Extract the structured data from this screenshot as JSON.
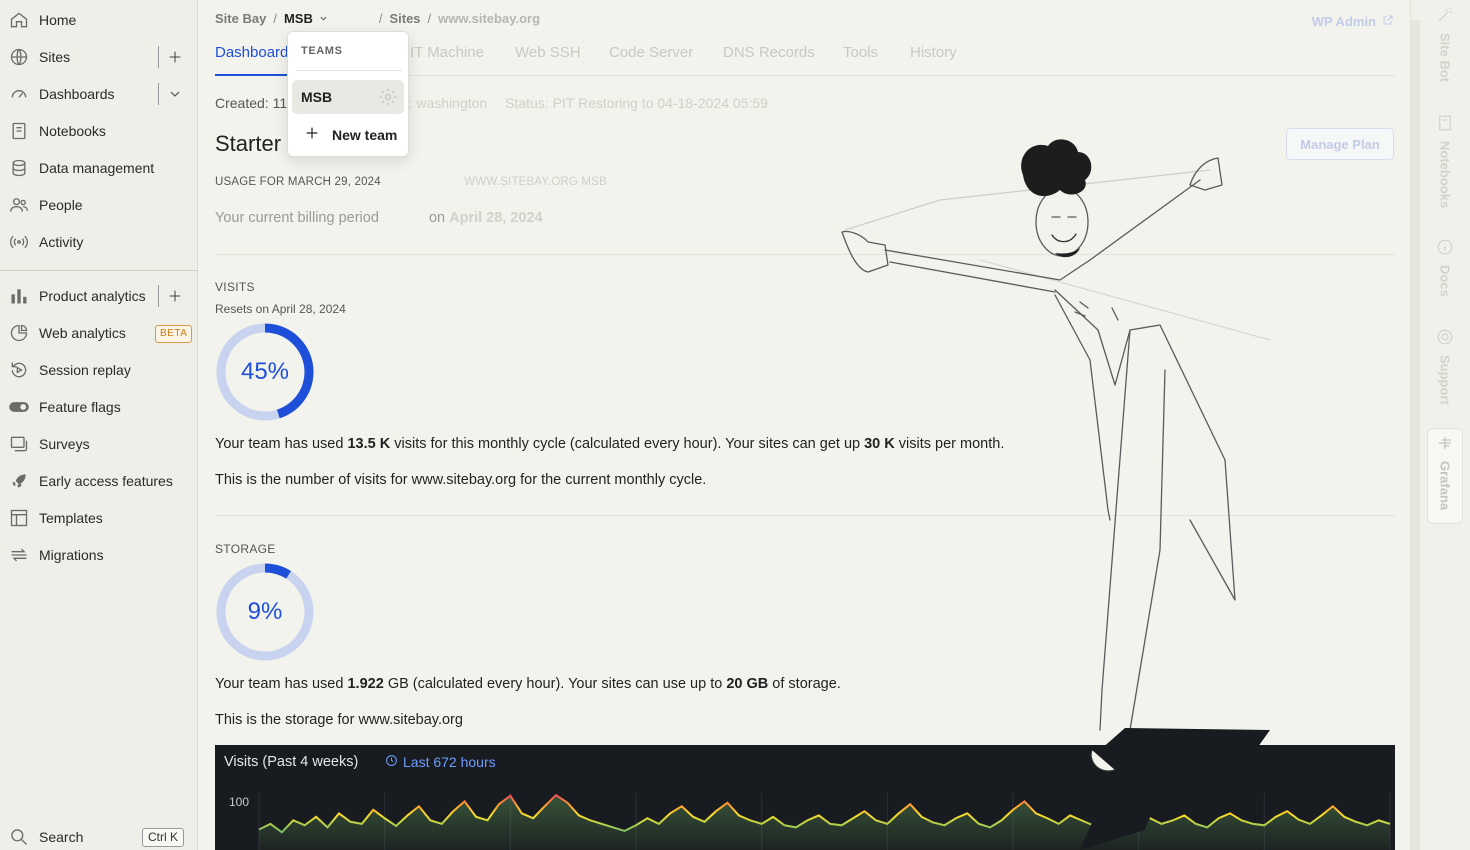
{
  "sidebar": {
    "items": [
      {
        "label": "Home",
        "icon": "home-icon"
      },
      {
        "label": "Sites",
        "icon": "globe-icon"
      },
      {
        "label": "Dashboards",
        "icon": "gauge-icon"
      },
      {
        "label": "Notebooks",
        "icon": "notebook-icon"
      },
      {
        "label": "Data management",
        "icon": "database-icon"
      },
      {
        "label": "People",
        "icon": "people-icon"
      },
      {
        "label": "Activity",
        "icon": "broadcast-icon"
      },
      {
        "label": "Product analytics",
        "icon": "bar-chart-icon"
      },
      {
        "label": "Web analytics",
        "icon": "pie-icon",
        "badge": "BETA"
      },
      {
        "label": "Session replay",
        "icon": "replay-icon"
      },
      {
        "label": "Feature flags",
        "icon": "toggle-icon"
      },
      {
        "label": "Surveys",
        "icon": "survey-icon"
      },
      {
        "label": "Early access features",
        "icon": "rocket-icon"
      },
      {
        "label": "Templates",
        "icon": "template-icon"
      },
      {
        "label": "Migrations",
        "icon": "migration-icon"
      }
    ],
    "search_label": "Search",
    "search_shortcut": "Ctrl K"
  },
  "breadcrumb": {
    "org": "Site Bay",
    "team": "MSB",
    "section": "Sites",
    "site": "www.sitebay.org"
  },
  "wp_admin": "WP Admin",
  "tabs": [
    "Dashboard",
    "PIT Machine",
    "Web SSH",
    "Code Server",
    "DNS Records",
    "Tools",
    "History"
  ],
  "meta": {
    "created_label": "Created:",
    "created_value": "11",
    "region": "on: washington",
    "status": "Status: PIT Restoring to 04-18-2024 05:59"
  },
  "plan": {
    "title": "Starter",
    "manage_label": "Manage Plan",
    "usage_for": "USAGE FOR MARCH 29, 2024",
    "usage_site": "WWW.SITEBAY.ORG MSB",
    "billing_prefix": "Your current billing period",
    "billing_mid": "on",
    "billing_date": "April 28, 2024"
  },
  "visits": {
    "label": "VISITS",
    "resets": "Resets on April 28, 2024",
    "percent_text": "45%",
    "percent": 45,
    "line1_a": "Your team has used",
    "line1_used": "13.5 K",
    "line1_b": "visits for this monthly cycle (calculated every hour). Your sites can get up",
    "line1_limit": "30 K",
    "line1_c": "visits per month.",
    "line2": "This is the number of visits for www.sitebay.org for the current monthly cycle."
  },
  "storage": {
    "label": "STORAGE",
    "percent_text": "9%",
    "percent": 9,
    "line1_a": "Your team has used",
    "line1_used": "1.922",
    "line1_b": "GB (calculated every hour). Your sites can use up to",
    "line1_limit": "20 GB",
    "line1_c": "of storage.",
    "line2": "This is the storage for www.sitebay.org"
  },
  "chart_panel": {
    "title": "Visits (Past 4 weeks)",
    "range": "Last 672 hours",
    "y_tick": "100"
  },
  "chart_data": {
    "type": "line",
    "title": "Visits (Past 4 weeks)",
    "xlabel": "",
    "ylabel": "",
    "ylim": [
      0,
      100
    ],
    "values": [
      22,
      30,
      18,
      35,
      28,
      40,
      25,
      45,
      33,
      30,
      50,
      38,
      27,
      42,
      55,
      35,
      30,
      48,
      62,
      40,
      35,
      58,
      70,
      45,
      38,
      55,
      80,
      60,
      42,
      35,
      30,
      25,
      20,
      28,
      38,
      30,
      45,
      55,
      40,
      33,
      48,
      60,
      42,
      35,
      30,
      40,
      28,
      25,
      35,
      42,
      30,
      28,
      38,
      48,
      35,
      30,
      45,
      58,
      40,
      32,
      28,
      38,
      45,
      30,
      25,
      35,
      50,
      62,
      45,
      38,
      30,
      42,
      35,
      28,
      40,
      55,
      65,
      48,
      38,
      30,
      35,
      42,
      30,
      25,
      38,
      45,
      35,
      30,
      28,
      40,
      48,
      36,
      30,
      42,
      55,
      40,
      33,
      28,
      35,
      30
    ],
    "series_colors": [
      "#73bf69",
      "#fade2a",
      "#ff9830",
      "#f2495c"
    ]
  },
  "right_rail": {
    "items": [
      "Site Bot",
      "Notebooks",
      "Docs",
      "Support",
      "Grafana"
    ]
  },
  "dropdown": {
    "header": "TEAMS",
    "team": "MSB",
    "new_team": "New team"
  }
}
